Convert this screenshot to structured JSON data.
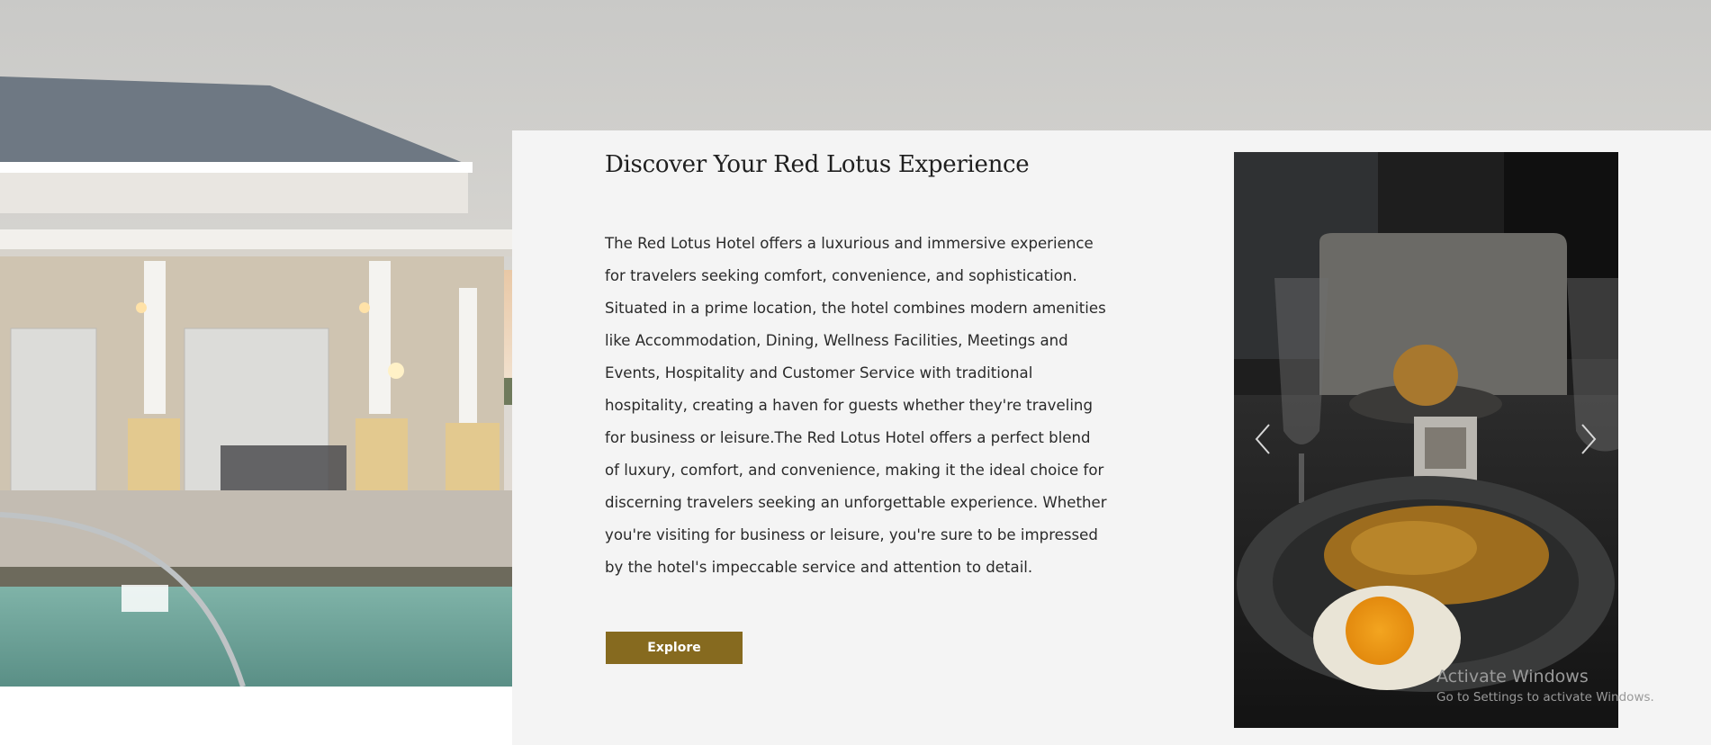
{
  "section": {
    "title": "Discover Your Red Lotus Experience",
    "description": "The Red Lotus Hotel offers a luxurious and immersive experience for travelers seeking comfort, convenience, and sophistication. Situated in a prime location, the hotel combines modern amenities like Accommodation, Dining, Wellness Facilities, Meetings and Events, Hospitality and Customer Service with traditional hospitality, creating a haven for guests whether they're traveling for business or leisure.The Red Lotus Hotel offers a perfect blend of luxury, comfort, and convenience, making it the ideal choice for discerning travelers seeking an unforgettable experience. Whether you're visiting for business or leisure, you're sure to be impressed by the hotel's impeccable service and attention to detail.",
    "button_label": "Explore"
  },
  "slider": {
    "prev_icon": "chevron-left-icon",
    "next_icon": "chevron-right-icon"
  },
  "watermark": {
    "line1": "Activate Windows",
    "line2": "Go to Settings to activate Windows."
  },
  "colors": {
    "accent": "#866a1f",
    "panel_bg": "#f4f4f4",
    "title_text": "#1f1f1f"
  }
}
